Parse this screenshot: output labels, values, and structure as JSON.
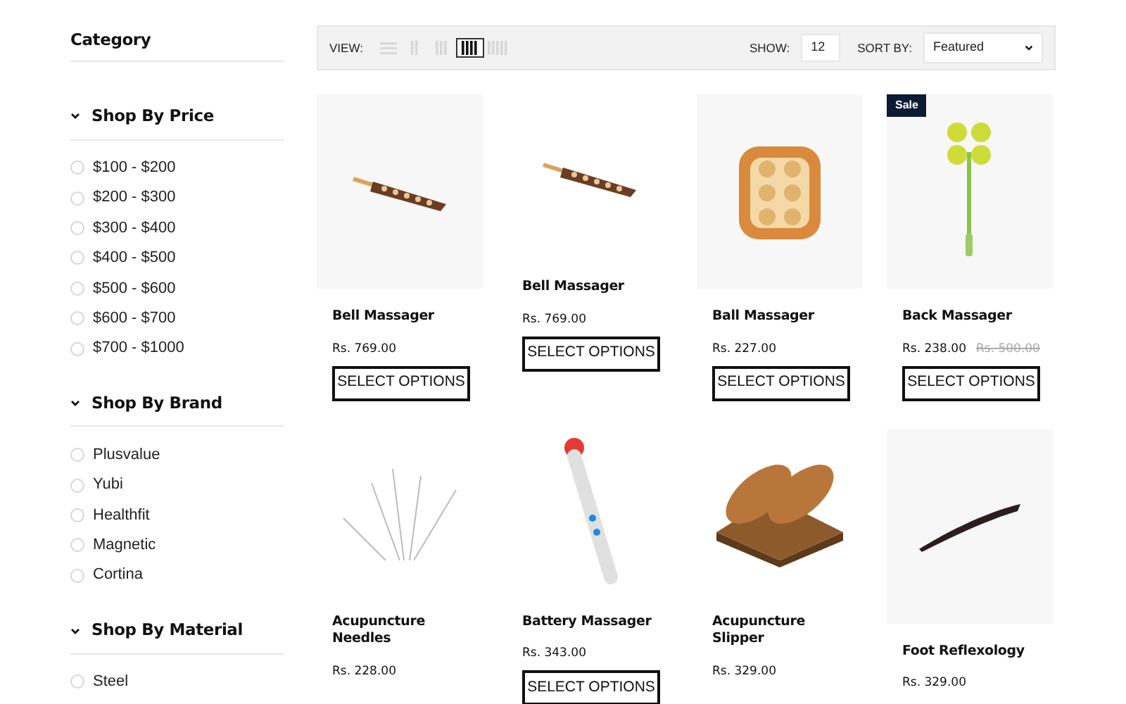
{
  "sidebar": {
    "category_title": "Category",
    "sections": [
      {
        "title": "Shop By Price",
        "expanded": true,
        "options": [
          {
            "label": "$100 - $200",
            "selected": false
          },
          {
            "label": "$200 - $300",
            "selected": false
          },
          {
            "label": "$300 - $400",
            "selected": false
          },
          {
            "label": "$400 - $500",
            "selected": false
          },
          {
            "label": "$500 - $600",
            "selected": false
          },
          {
            "label": "$600 - $700",
            "selected": false
          },
          {
            "label": "$700 - $1000",
            "selected": false
          }
        ]
      },
      {
        "title": "Shop By Brand",
        "expanded": true,
        "options": [
          {
            "label": "Plusvalue",
            "selected": false
          },
          {
            "label": "Yubi",
            "selected": false
          },
          {
            "label": "Healthfit",
            "selected": false
          },
          {
            "label": "Magnetic",
            "selected": false
          },
          {
            "label": "Cortina",
            "selected": false
          }
        ]
      },
      {
        "title": "Shop By Material",
        "expanded": true,
        "options": [
          {
            "label": "Steel",
            "selected": false
          }
        ]
      }
    ]
  },
  "toolbar": {
    "view_label": "VIEW:",
    "views": [
      {
        "kind": "list",
        "selected": false
      },
      {
        "kind": "grid2",
        "selected": false
      },
      {
        "kind": "grid3",
        "selected": false
      },
      {
        "kind": "grid4",
        "selected": true
      },
      {
        "kind": "grid5",
        "selected": false
      }
    ],
    "show_label": "SHOW:",
    "show_value": "12",
    "sort_label": "SORT BY:",
    "sort_value": "Featured"
  },
  "products": [
    {
      "name": "Bell Massager",
      "price": "Rs. 769.00",
      "kind": "boxed",
      "button": "SELECT OPTIONS"
    },
    {
      "name": "Bell Massager",
      "price": "Rs. 769.00",
      "kind": "plain",
      "button": "SELECT OPTIONS"
    },
    {
      "name": "Ball Massager",
      "price": "Rs. 227.00",
      "kind": "boxed",
      "button": "SELECT OPTIONS"
    },
    {
      "name": "Back Massager",
      "price": "Rs. 238.00",
      "old_price": "Rs. 500.00",
      "badge": "Sale",
      "kind": "boxed",
      "button": "SELECT OPTIONS"
    },
    {
      "name": "Acupuncture Needles",
      "price": "Rs. 228.00",
      "kind": "plain"
    },
    {
      "name": "Battery Massager",
      "price": "Rs. 343.00",
      "kind": "plain",
      "button": "SELECT OPTIONS"
    },
    {
      "name": "Acupuncture Slipper",
      "price": "Rs. 329.00",
      "kind": "plain"
    },
    {
      "name": "Foot Reflexology",
      "price": "Rs. 329.00",
      "kind": "boxed"
    }
  ]
}
